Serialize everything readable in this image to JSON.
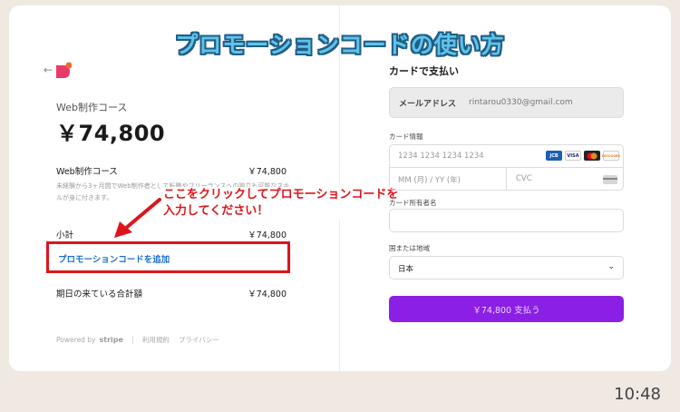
{
  "headline": "プロモーションコードの使い方",
  "order": {
    "course_name": "Web制作コース",
    "price_big": "￥74,800",
    "item_name": "Web制作コース",
    "item_price": "￥74,800",
    "item_desc": "未経験から3ヶ月間でWeb制作者として転職やフリーランスへの独立も可能なスキルが身に付きます。",
    "subtotal_label": "小計",
    "subtotal_value": "￥74,800",
    "promo_link": "プロモーションコードを追加",
    "total_label": "期日の来ている合計額",
    "total_value": "￥74,800"
  },
  "annotation": {
    "line1": "ここをクリックしてプロモーションコードを",
    "line2": "入力してください！"
  },
  "footer": {
    "powered_by": "Powered by",
    "stripe": "stripe",
    "terms": "利用規約",
    "privacy": "プライバシー"
  },
  "payment": {
    "title": "カードで支払い",
    "email_label": "メールアドレス",
    "email_value": "rintarou0330@gmail.com",
    "card_info_label": "カード情報",
    "card_number_placeholder": "1234 1234 1234 1234",
    "expiry_placeholder": "MM (月) / YY (年)",
    "cvc_placeholder": "CVC",
    "brands": [
      "JCB",
      "VISA",
      "MC",
      "DISCOVER"
    ],
    "cardholder_label": "カード所有者名",
    "country_label": "国または地域",
    "country_value": "日本",
    "pay_button": "￥74,800 支払う",
    "accent_color": "#8c1fe6"
  },
  "status_bar": {
    "time": "10:48"
  }
}
